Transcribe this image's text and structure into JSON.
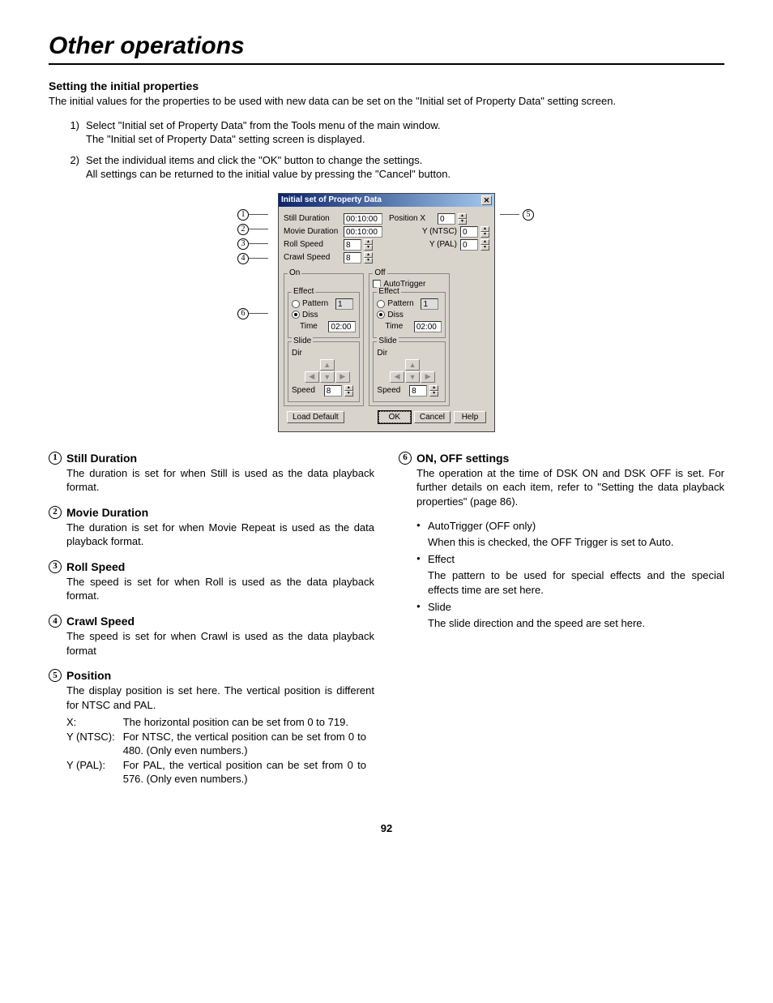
{
  "page": {
    "title": "Other operations",
    "number": "92"
  },
  "section": {
    "heading": "Setting the initial properties",
    "intro": "The initial values for the properties to be used with new data can be set on the \"Initial set of Property Data\" setting screen.",
    "step1_num": "1)",
    "step1_line1": "Select \"Initial set of Property Data\" from the Tools menu of the main window.",
    "step1_line2": "The \"Initial set of Property Data\" setting screen is displayed.",
    "step2_num": "2)",
    "step2_line1": "Set the individual items and click the \"OK\" button to change the settings.",
    "step2_line2": "All settings can be returned to the initial value by pressing the \"Cancel\" button."
  },
  "callout": {
    "n1": "1",
    "n2": "2",
    "n3": "3",
    "n4": "4",
    "n5": "5",
    "n6": "6"
  },
  "dialog": {
    "title": "Initial set of Property Data",
    "close_glyph": "✕",
    "still_duration_label": "Still Duration",
    "still_duration_value": "00:10:00",
    "movie_duration_label": "Movie Duration",
    "movie_duration_value": "00:10:00",
    "roll_speed_label": "Roll Speed",
    "roll_speed_value": "8",
    "crawl_speed_label": "Crawl Speed",
    "crawl_speed_value": "8",
    "position_x_label": "Position X",
    "position_x_value": "0",
    "y_ntsc_label": "Y (NTSC)",
    "y_ntsc_value": "0",
    "y_pal_label": "Y (PAL)",
    "y_pal_value": "0",
    "on_legend": "On",
    "off_legend": "Off",
    "autotrigger_label": "AutoTrigger",
    "effect_legend": "Effect",
    "pattern_label": "Pattern",
    "pattern_value": "1",
    "diss_label": "Diss",
    "time_label": "Time",
    "time_value": "02:00",
    "slide_legend": "Slide",
    "dir_label": "Dir",
    "speed_label": "Speed",
    "speed_value": "8",
    "btn_load_default": "Load Default",
    "btn_ok": "OK",
    "btn_cancel": "Cancel",
    "btn_help": "Help",
    "arrow_up": "▲",
    "arrow_down": "▼",
    "arrow_left": "◀",
    "arrow_right": "▶"
  },
  "entries": {
    "e1_title": "Still Duration",
    "e1_body": "The duration is set for when Still is used as the data playback format.",
    "e2_title": "Movie Duration",
    "e2_body": "The duration is set for when Movie Repeat is used as the data playback format.",
    "e3_title": "Roll Speed",
    "e3_body": "The speed is set for when Roll is used as the data playback format.",
    "e4_title": "Crawl Speed",
    "e4_body": "The speed is set for when Crawl is used as the data playback format",
    "e5_title": "Position",
    "e5_body": "The display position is set here.  The vertical position is different for NTSC and PAL.",
    "e5_x_k": "X:",
    "e5_x_v": "The horizontal position can be set from 0 to 719.",
    "e5_yn_k": "Y (NTSC):",
    "e5_yn_v": "For NTSC, the vertical position can be set from 0 to 480. (Only even numbers.)",
    "e5_yp_k": "Y (PAL):",
    "e5_yp_v": "For PAL, the vertical position can be set from 0 to 576. (Only even numbers.)",
    "e6_title": "ON, OFF settings",
    "e6_body": "The operation at the time of DSK ON and DSK OFF is set.  For further details on each item, refer to \"Setting the data playback properties\" (page 86).",
    "e6_b1_t": "AutoTrigger (OFF only)",
    "e6_b1_d": "When this is checked, the OFF Trigger is set to Auto.",
    "e6_b2_t": "Effect",
    "e6_b2_d": "The pattern to be used for special effects and the special effects time are set here.",
    "e6_b3_t": "Slide",
    "e6_b3_d": "The slide direction and the speed are set here."
  }
}
